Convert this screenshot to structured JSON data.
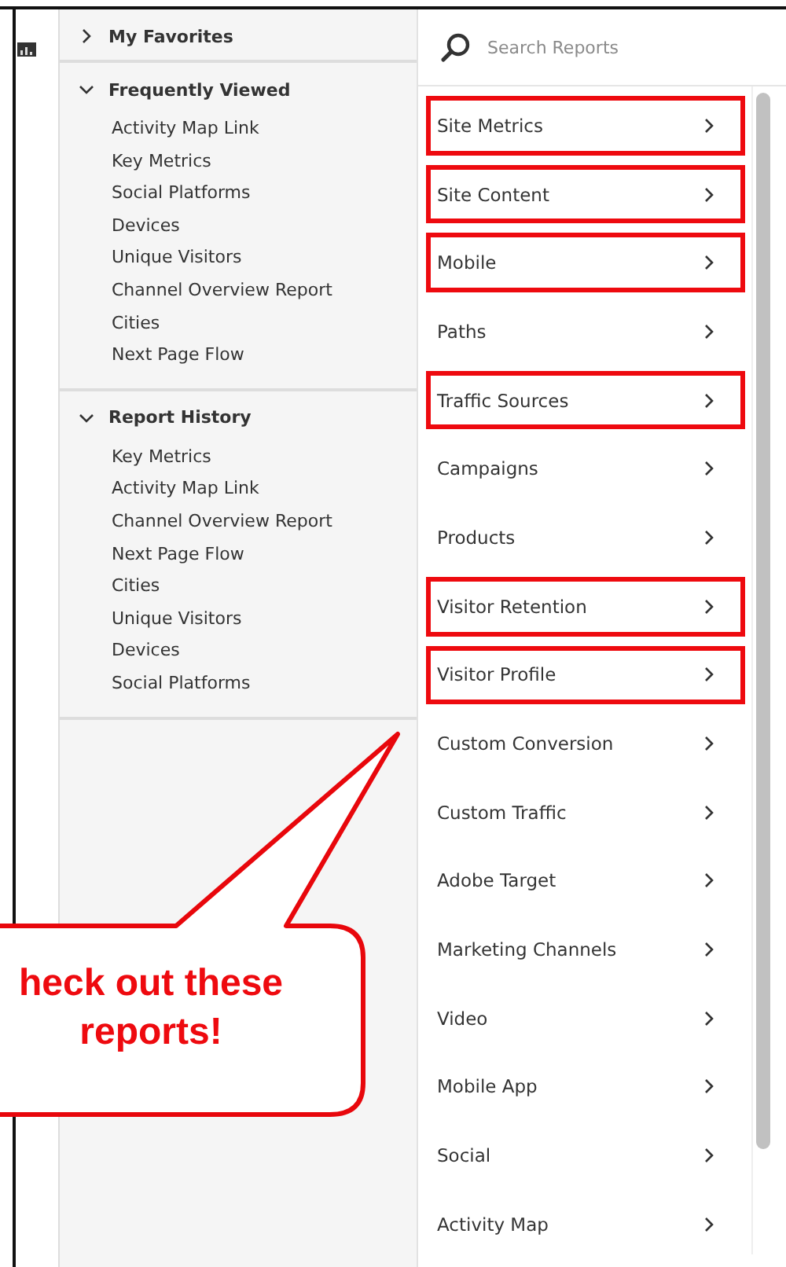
{
  "sidebar": {
    "sections": [
      {
        "title": "My Favorites",
        "expanded": false
      },
      {
        "title": "Frequently Viewed",
        "expanded": true,
        "items": [
          "Activity Map Link",
          "Key Metrics",
          "Social Platforms",
          "Devices",
          "Unique Visitors",
          "Channel Overview Report",
          "Cities",
          "Next Page Flow"
        ]
      },
      {
        "title": "Report History",
        "expanded": true,
        "items": [
          "Key Metrics",
          "Activity Map Link",
          "Channel Overview Report",
          "Next Page Flow",
          "Cities",
          "Unique Visitors",
          "Devices",
          "Social Platforms"
        ]
      }
    ]
  },
  "search": {
    "placeholder": "Search Reports"
  },
  "reports": [
    {
      "label": "Site Metrics",
      "highlighted": true
    },
    {
      "label": "Site Content",
      "highlighted": true
    },
    {
      "label": "Mobile",
      "highlighted": true
    },
    {
      "label": "Paths",
      "highlighted": false
    },
    {
      "label": "Traffic Sources",
      "highlighted": true
    },
    {
      "label": "Campaigns",
      "highlighted": false
    },
    {
      "label": "Products",
      "highlighted": false
    },
    {
      "label": "Visitor Retention",
      "highlighted": true
    },
    {
      "label": "Visitor Profile",
      "highlighted": true
    },
    {
      "label": "Custom Conversion",
      "highlighted": false
    },
    {
      "label": "Custom Traffic",
      "highlighted": false
    },
    {
      "label": "Adobe Target",
      "highlighted": false
    },
    {
      "label": "Marketing Channels",
      "highlighted": false
    },
    {
      "label": "Video",
      "highlighted": false
    },
    {
      "label": "Mobile App",
      "highlighted": false
    },
    {
      "label": "Social",
      "highlighted": false
    },
    {
      "label": "Activity Map",
      "highlighted": false
    }
  ],
  "callout": {
    "text": "heck out these reports!"
  }
}
